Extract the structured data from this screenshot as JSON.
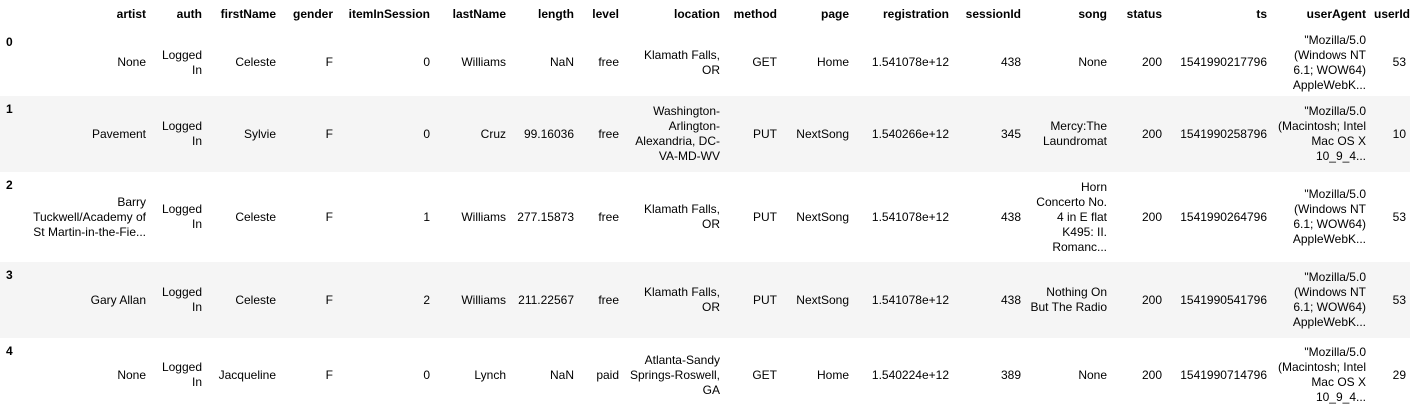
{
  "columns": [
    "",
    "artist",
    "auth",
    "firstName",
    "gender",
    "itemInSession",
    "lastName",
    "length",
    "level",
    "location",
    "method",
    "page",
    "registration",
    "sessionId",
    "song",
    "status",
    "ts",
    "userAgent",
    "userId"
  ],
  "rows": [
    {
      "index": "0",
      "cells": [
        "None",
        "Logged In",
        "Celeste",
        "F",
        "0",
        "Williams",
        "NaN",
        "free",
        "Klamath Falls, OR",
        "GET",
        "Home",
        "1.541078e+12",
        "438",
        "None",
        "200",
        "1541990217796",
        "\"Mozilla/5.0 (Windows NT 6.1; WOW64) AppleWebK...",
        "53"
      ]
    },
    {
      "index": "1",
      "cells": [
        "Pavement",
        "Logged In",
        "Sylvie",
        "F",
        "0",
        "Cruz",
        "99.16036",
        "free",
        "Washington-Arlington-Alexandria, DC-VA-MD-WV",
        "PUT",
        "NextSong",
        "1.540266e+12",
        "345",
        "Mercy:The Laundromat",
        "200",
        "1541990258796",
        "\"Mozilla/5.0 (Macintosh; Intel Mac OS X 10_9_4...",
        "10"
      ]
    },
    {
      "index": "2",
      "cells": [
        "Barry Tuckwell/Academy of St Martin-in-the-Fie...",
        "Logged In",
        "Celeste",
        "F",
        "1",
        "Williams",
        "277.15873",
        "free",
        "Klamath Falls, OR",
        "PUT",
        "NextSong",
        "1.541078e+12",
        "438",
        "Horn Concerto No. 4 in E flat K495: II. Romanc...",
        "200",
        "1541990264796",
        "\"Mozilla/5.0 (Windows NT 6.1; WOW64) AppleWebK...",
        "53"
      ]
    },
    {
      "index": "3",
      "cells": [
        "Gary Allan",
        "Logged In",
        "Celeste",
        "F",
        "2",
        "Williams",
        "211.22567",
        "free",
        "Klamath Falls, OR",
        "PUT",
        "NextSong",
        "1.541078e+12",
        "438",
        "Nothing On But The Radio",
        "200",
        "1541990541796",
        "\"Mozilla/5.0 (Windows NT 6.1; WOW64) AppleWebK...",
        "53"
      ]
    },
    {
      "index": "4",
      "cells": [
        "None",
        "Logged In",
        "Jacqueline",
        "F",
        "0",
        "Lynch",
        "NaN",
        "paid",
        "Atlanta-Sandy Springs-Roswell, GA",
        "GET",
        "Home",
        "1.540224e+12",
        "389",
        "None",
        "200",
        "1541990714796",
        "\"Mozilla/5.0 (Macintosh; Intel Mac OS X 10_9_4...",
        "29"
      ]
    }
  ]
}
